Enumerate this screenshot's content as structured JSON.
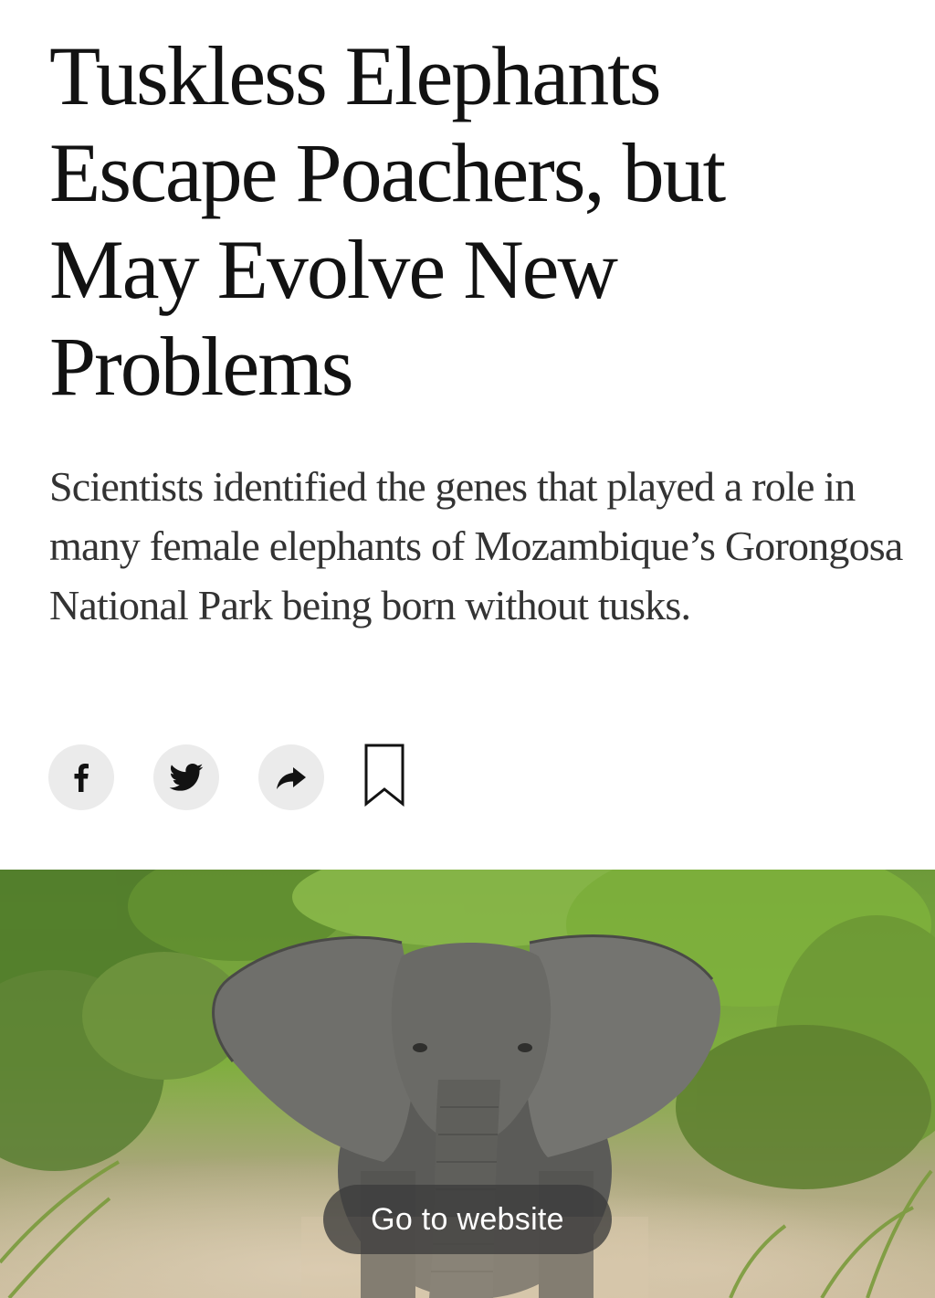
{
  "article": {
    "headline": "Tuskless Elephants Escape Poachers, but May Evolve New Problems",
    "summary": "Scientists identified the genes that played a role in many female elephants of Mozambique’s Gorongosa National Park being born without tusks."
  },
  "share_bar": {
    "icons": [
      "facebook-icon",
      "twitter-icon",
      "share-arrow-icon",
      "bookmark-icon"
    ]
  },
  "overlay": {
    "go_to_website_label": "Go to website"
  },
  "colors": {
    "text": "#121212",
    "summary_text": "#333333",
    "icon_bg": "#ebebeb",
    "overlay_bg": "#3c3c3c"
  }
}
